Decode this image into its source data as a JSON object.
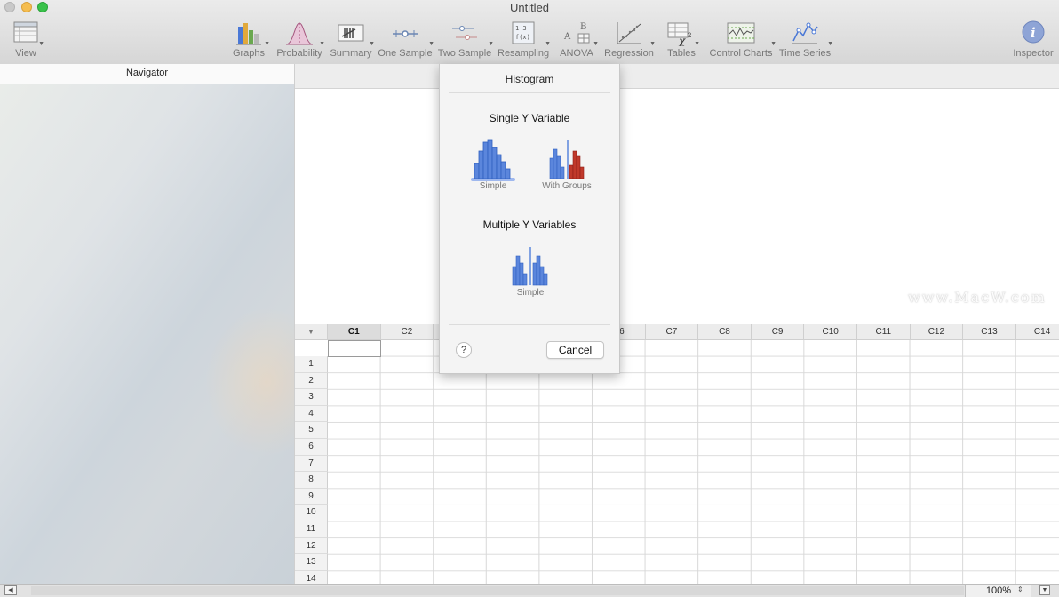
{
  "window": {
    "title": "Untitled"
  },
  "toolbar": {
    "view": "View",
    "graphs": "Graphs",
    "probability": "Probability",
    "summary": "Summary",
    "one_sample": "One Sample",
    "two_sample": "Two Sample",
    "resampling": "Resampling",
    "anova": "ANOVA",
    "regression": "Regression",
    "tables": "Tables",
    "control_charts": "Control Charts",
    "time_series": "Time Series",
    "inspector": "Inspector"
  },
  "navigator": {
    "title": "Navigator"
  },
  "popover": {
    "title": "Histogram",
    "single_heading": "Single Y Variable",
    "single_options": [
      "Simple",
      "With Groups"
    ],
    "multiple_heading": "Multiple Y Variables",
    "multiple_options": [
      "Simple"
    ],
    "help_label": "?",
    "cancel_label": "Cancel"
  },
  "sheet": {
    "columns": [
      "C1",
      "C2",
      "C3",
      "C4",
      "C5",
      "C6",
      "C7",
      "C8",
      "C9",
      "C10",
      "C11",
      "C12",
      "C13",
      "C14"
    ],
    "rows": [
      "1",
      "2",
      "3",
      "4",
      "5",
      "6",
      "7",
      "8",
      "9",
      "10",
      "11",
      "12",
      "13",
      "14"
    ],
    "selected_column": "C1"
  },
  "statusbar": {
    "zoom": "100%"
  },
  "watermark": "www.MacW.com",
  "colors": {
    "accent_blue": "#4a78d6",
    "group_red": "#c0392b",
    "close": "#c9c9c9",
    "minimize": "#f5bd4f",
    "maximize": "#39c24a"
  }
}
